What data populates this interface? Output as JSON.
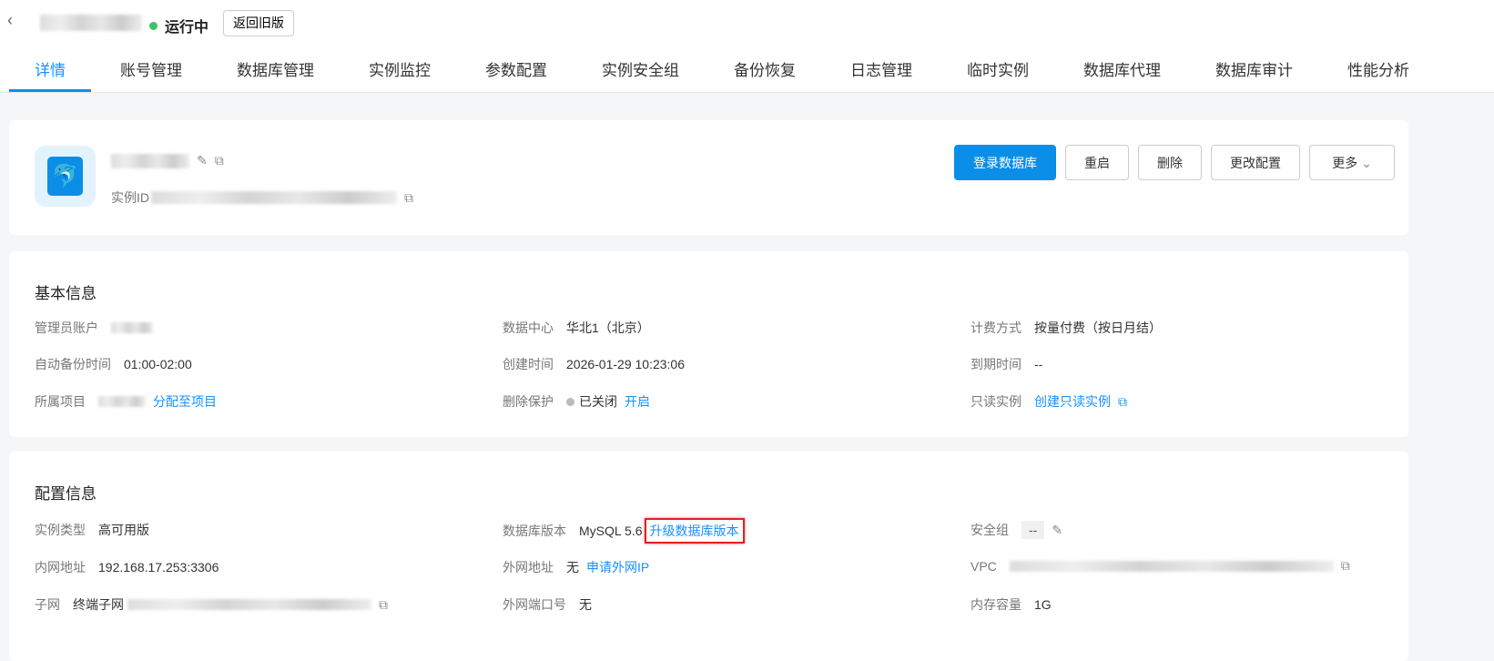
{
  "header": {
    "status": "运行中",
    "old_version_button": "返回旧版"
  },
  "tabs": [
    "详情",
    "账号管理",
    "数据库管理",
    "实例监控",
    "参数配置",
    "实例安全组",
    "备份恢复",
    "日志管理",
    "临时实例",
    "数据库代理",
    "数据库审计",
    "性能分析"
  ],
  "instance": {
    "id_label": "实例ID"
  },
  "actions": {
    "login": "登录数据库",
    "restart": "重启",
    "delete": "删除",
    "change_config": "更改配置",
    "more": "更多"
  },
  "basic": {
    "title": "基本信息",
    "admin_label": "管理员账户",
    "backup_label": "自动备份时间",
    "backup_value": "01:00-02:00",
    "project_label": "所属项目",
    "project_link": "分配至项目",
    "dc_label": "数据中心",
    "dc_value": "华北1（北京）",
    "created_label": "创建时间",
    "created_value": "2026-01-29 10:23:06",
    "protect_label": "删除保护",
    "protect_value": "已关闭",
    "protect_link": "开启",
    "billing_label": "计费方式",
    "billing_value": "按量付费（按日月结）",
    "expire_label": "到期时间",
    "expire_value": "--",
    "readonly_label": "只读实例",
    "readonly_link": "创建只读实例"
  },
  "config": {
    "title": "配置信息",
    "type_label": "实例类型",
    "type_value": "高可用版",
    "ip_label": "内网地址",
    "ip_value": "192.168.17.253:3306",
    "subnet_label": "子网",
    "subnet_value": "终端子网",
    "ver_label": "数据库版本",
    "ver_value": "MySQL 5.6",
    "ver_link": "升级数据库版本",
    "extip_label": "外网地址",
    "extip_value": "无",
    "extip_link": "申请外网IP",
    "extport_label": "外网端口号",
    "extport_value": "无",
    "sg_label": "安全组",
    "sg_value": "--",
    "vpc_label": "VPC",
    "mem_label": "内存容量",
    "mem_value": "1G"
  }
}
